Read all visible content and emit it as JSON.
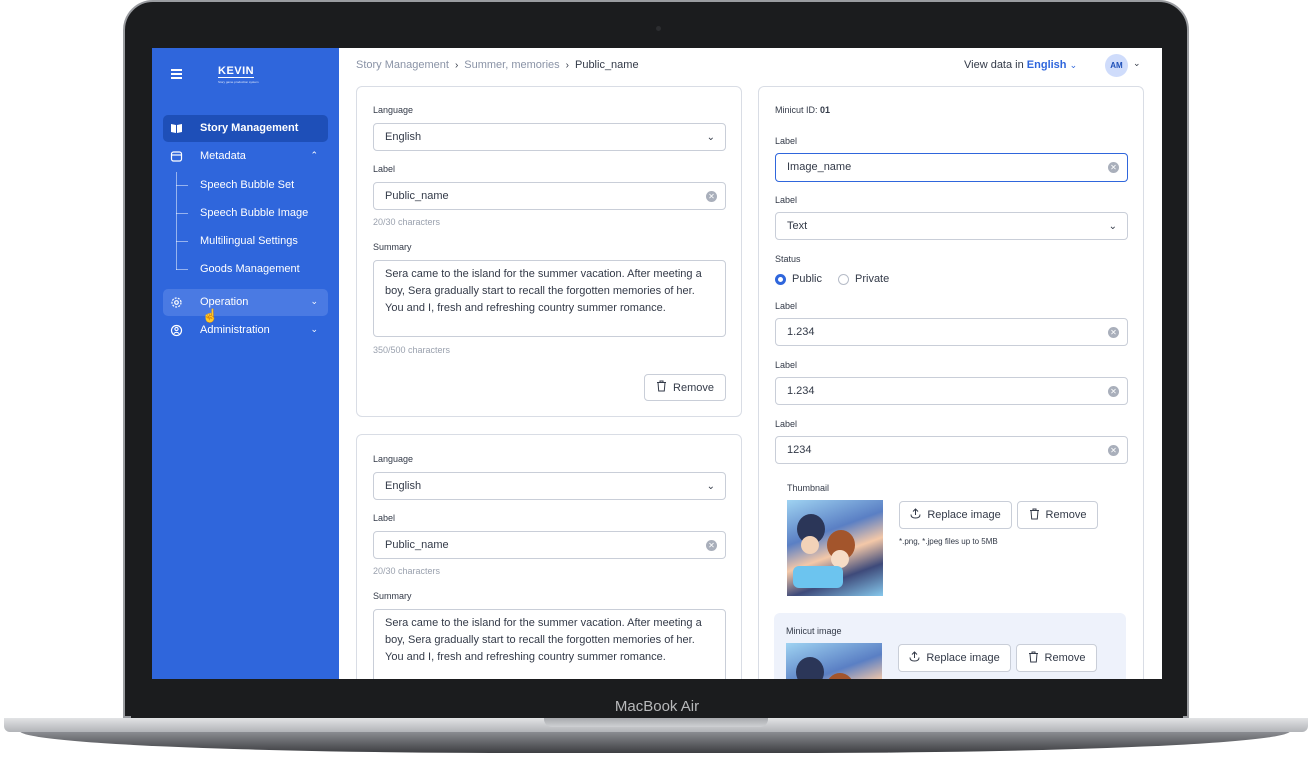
{
  "device": {
    "label": "MacBook Air"
  },
  "sidebar": {
    "brand": "KEVIN",
    "brand_sub": "Story game production system",
    "items": [
      {
        "label": "Story Management",
        "icon": "book-icon"
      },
      {
        "label": "Metadata",
        "icon": "chat-icon"
      },
      {
        "label": "Operation",
        "icon": "gear-icon"
      },
      {
        "label": "Administration",
        "icon": "user-icon"
      }
    ],
    "sub_items": [
      "Speech Bubble Set",
      "Speech Bubble Image",
      "Multilingual Settings",
      "Goods Management"
    ]
  },
  "header": {
    "breadcrumb": [
      "Story Management",
      "Summer, memories",
      "Public_name"
    ],
    "view_data_prefix": "View data in",
    "view_data_lang": "English",
    "avatar_initials": "AM"
  },
  "left_cards": [
    {
      "language_label": "Language",
      "language_value": "English",
      "label_label": "Label",
      "label_value": "Public_name",
      "label_count": "20/30 characters",
      "summary_label": "Summary",
      "summary_value": "Sera came to the island for the summer vacation. After meeting a boy, Sera gradually start to recall the forgotten memories of her. You and I, fresh and refreshing country summer romance.",
      "summary_count": "350/500 characters",
      "remove_label": "Remove"
    },
    {
      "language_label": "Language",
      "language_value": "English",
      "label_label": "Label",
      "label_value": "Public_name",
      "label_count": "20/30 characters",
      "summary_label": "Summary",
      "summary_value": "Sera came to the island for the summer vacation. After meeting a boy, Sera gradually start to recall the forgotten memories of her. You and I, fresh and refreshing country summer romance."
    }
  ],
  "right_card": {
    "minicut_id_label": "Minicut ID:",
    "minicut_id_value": "01",
    "fields": [
      {
        "label": "Label",
        "value": "Image_name"
      },
      {
        "label": "Label",
        "value": "Text"
      },
      {
        "label": "Label",
        "value": "1.234"
      },
      {
        "label": "Label",
        "value": "1.234"
      },
      {
        "label": "Label",
        "value": "1234"
      }
    ],
    "status_label": "Status",
    "status_options": [
      "Public",
      "Private"
    ],
    "status_selected": "Public",
    "thumbnail_label": "Thumbnail",
    "replace_label": "Replace image",
    "remove_label": "Remove",
    "file_hint": "*.png, *.jpeg files up to 5MB",
    "minicut_image_label": "Minicut image"
  },
  "colors": {
    "accent": "#2f66dc",
    "sidebar": "#2f66dc",
    "sidebar_active": "#1e4fb8"
  }
}
